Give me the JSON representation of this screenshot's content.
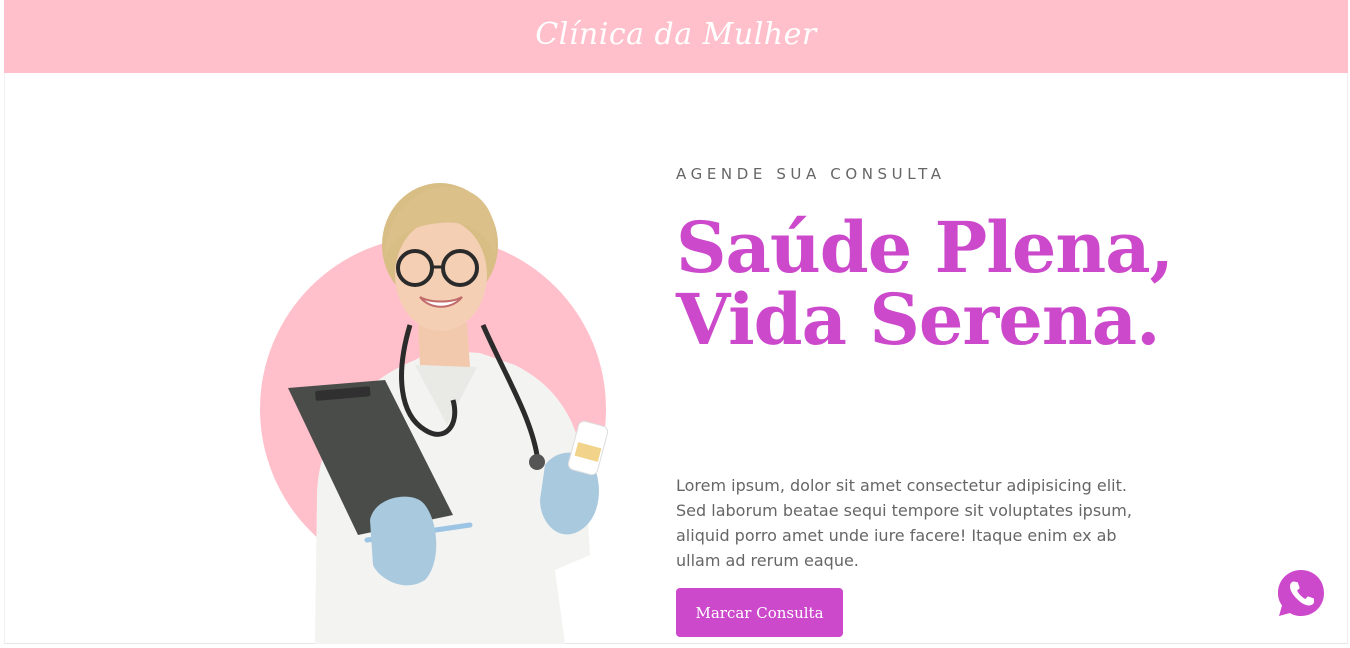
{
  "colors": {
    "header_bg": "#ffc0cb",
    "accent": "#cc49cc",
    "body_text": "#666666",
    "circle": "#ffc0cb",
    "whatsapp": "#cc49cc"
  },
  "header": {
    "brand": "Clínica da Mulher"
  },
  "hero": {
    "eyebrow": "AGENDE SUA CONSULTA",
    "headline": "Saúde Plena, Vida Serena.",
    "body": "Lorem ipsum, dolor sit amet consectetur adipisicing elit. Sed laborum beatae sequi tempore sit voluptates ipsum, aliquid porro amet unde iure facere! Itaque enim ex ab ullam ad rerum eaque.",
    "cta_label": "Marcar Consulta",
    "image_icon": "doctor-photo"
  },
  "floating": {
    "icon": "whatsapp-icon"
  }
}
